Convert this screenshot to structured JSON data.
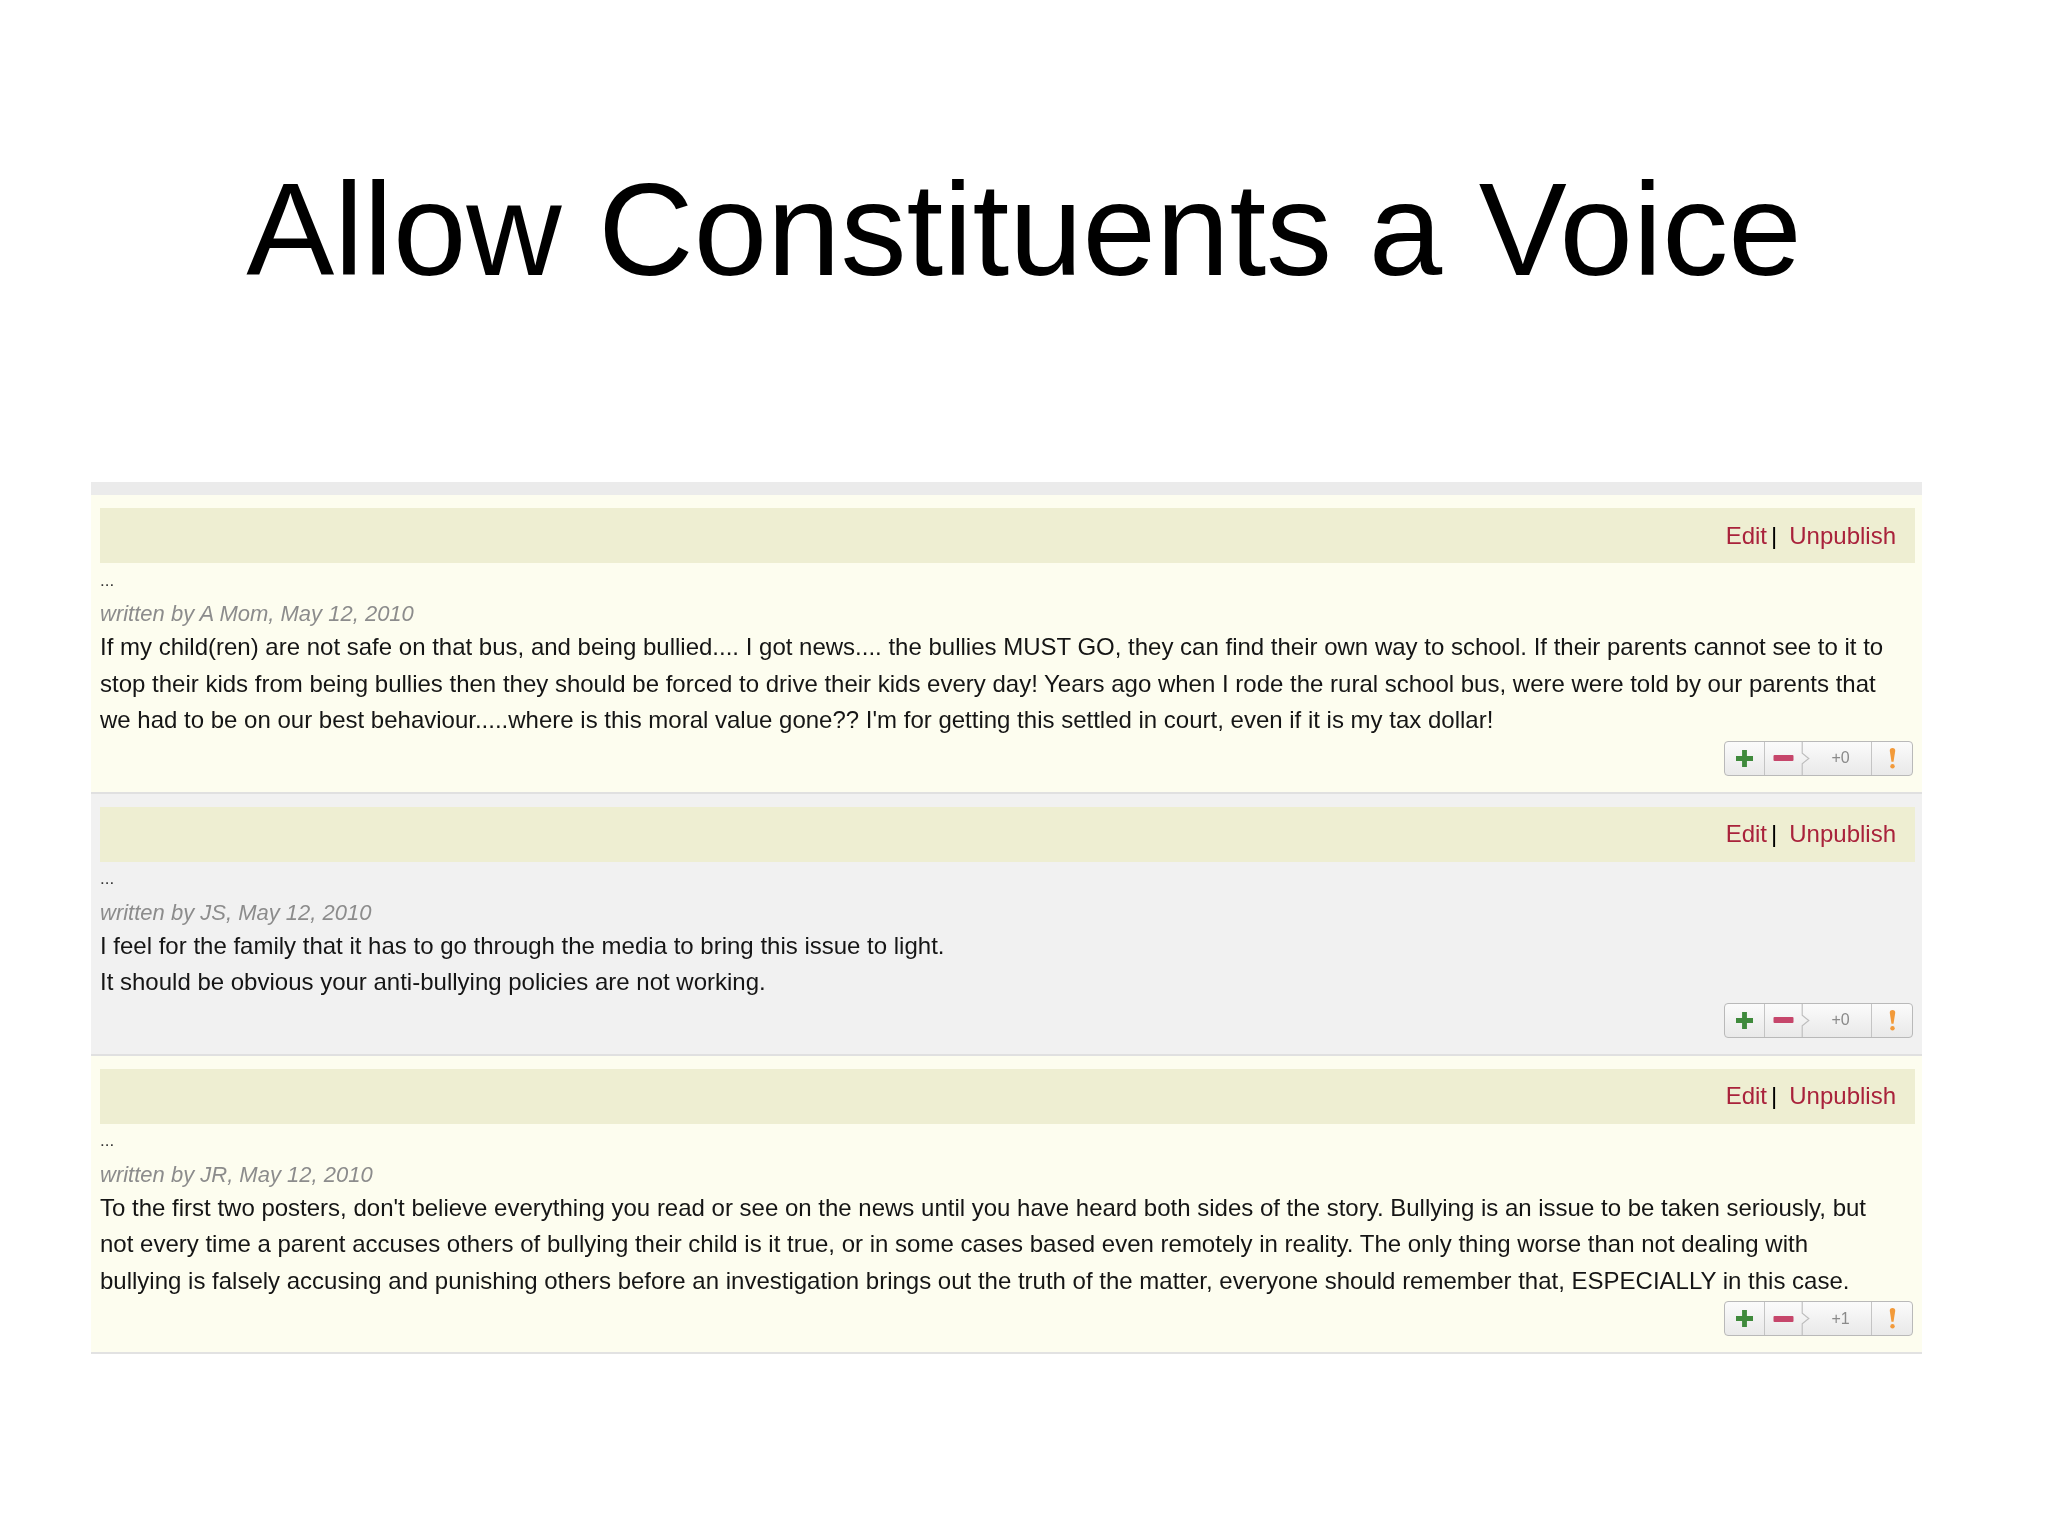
{
  "slide": {
    "title": "Allow Constituents a Voice"
  },
  "comments": [
    {
      "edit_link": "Edit",
      "separator": "|",
      "unpublish_link": "Unpublish",
      "ellipsis": "...",
      "byline": "written by A Mom, May 12, 2010",
      "body": [
        "If my child(ren) are not safe on that bus, and being bullied.... I got news.... the bullies MUST GO, they can find their own way to school. If their parents cannot see to it to stop their kids from being bullies then they should be forced to drive their kids every day! Years ago when I rode the rural school bus, were were told by our parents that we had to be on our best behaviour.....where is this moral value gone?? I'm for getting this settled in court, even if it is my tax dollar!"
      ],
      "score": "+0"
    },
    {
      "edit_link": "Edit",
      "separator": "|",
      "unpublish_link": "Unpublish",
      "ellipsis": "...",
      "byline": "written by JS, May 12, 2010",
      "body": [
        "I feel for the family that it has to go through the media to bring this issue to light.",
        "It should be obvious your anti-bullying policies are not working."
      ],
      "score": "+0"
    },
    {
      "edit_link": "Edit",
      "separator": "|",
      "unpublish_link": "Unpublish",
      "ellipsis": "...",
      "byline": "written by JR, May 12, 2010",
      "body": [
        "To the first two posters, don't believe everything you read or see on the news until you have heard both sides of the story. Bullying is an issue to be taken seriously, but not every time a parent accuses others of bullying their child is it true, or in some cases based even remotely in reality. The only thing worse than not dealing with bullying is falsely accusing and punishing others before an investigation brings out the truth of the matter, everyone should remember that, ESPECIALLY in this case."
      ],
      "score": "+1"
    }
  ]
}
